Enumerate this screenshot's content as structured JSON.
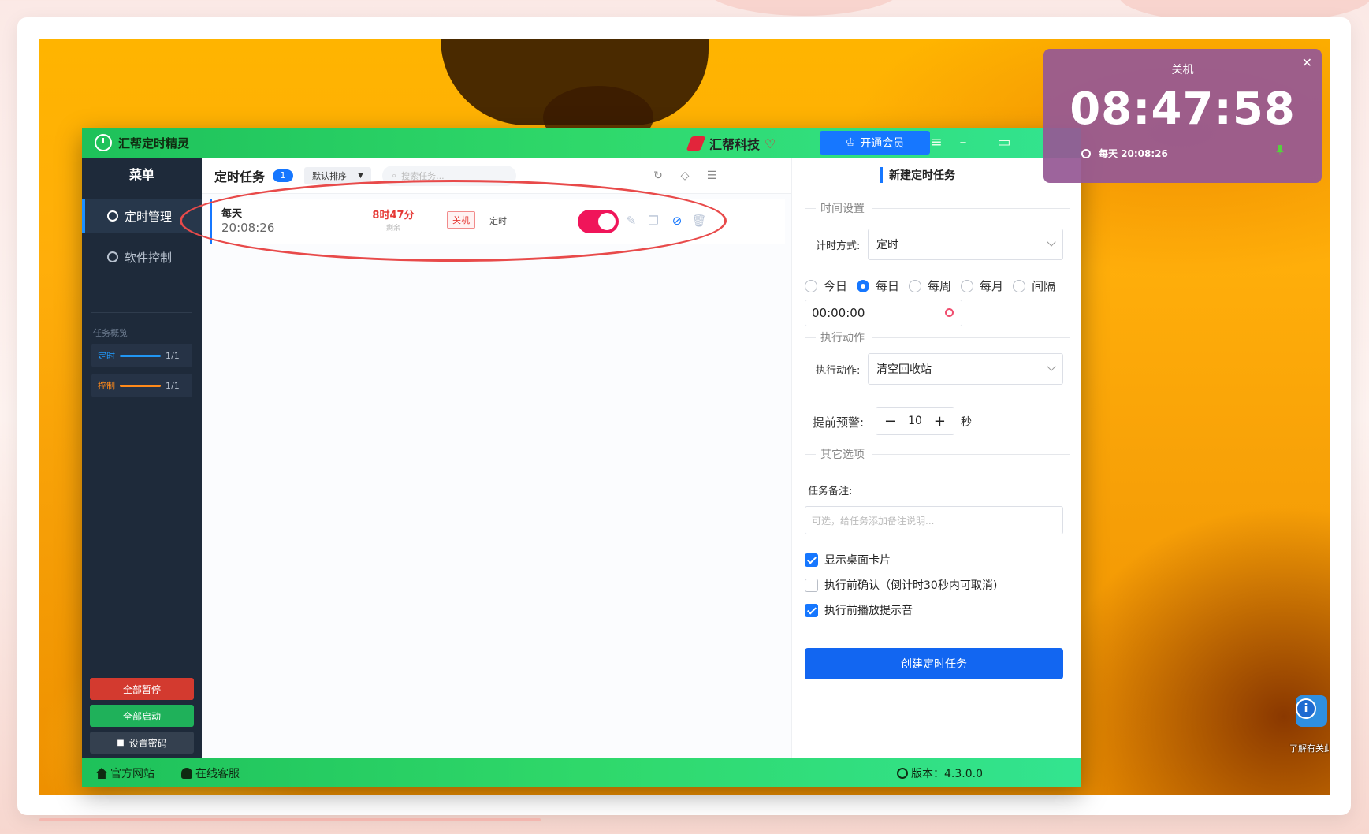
{
  "window": {
    "title": "汇帮定时精灵",
    "brand": "汇帮科技",
    "vip_label": "开通会员"
  },
  "sidebar": {
    "menu_title": "菜单",
    "items": [
      {
        "label": "定时管理"
      },
      {
        "label": "软件控制"
      }
    ],
    "overview_title": "任务概览",
    "overview": [
      {
        "label": "定时",
        "value": "1/1",
        "color": "#2196f3"
      },
      {
        "label": "控制",
        "value": "1/1",
        "color": "#ff8a1a"
      }
    ],
    "pause_all": "全部暂停",
    "start_all": "全部启动",
    "set_password": "设置密码"
  },
  "list": {
    "title": "定时任务",
    "count": "1",
    "sort": "默认排序",
    "search_placeholder": "搜索任务...",
    "tasks": [
      {
        "frequency": "每天",
        "time": "20:08:26",
        "remaining": "8时47分",
        "remaining_label": "剩余",
        "action": "关机",
        "type": "定时",
        "enabled": true
      }
    ]
  },
  "form": {
    "title": "新建定时任务",
    "time_section": "时间设置",
    "timing_mode_label": "计时方式:",
    "timing_mode": "定时",
    "options": [
      "今日",
      "每日",
      "每周",
      "每月",
      "间隔"
    ],
    "selected_option": "每日",
    "time_value": "00:00:00",
    "action_section": "执行动作",
    "action_label": "执行动作:",
    "action": "清空回收站",
    "warn_label": "提前预警:",
    "warn_value": "10",
    "warn_unit": "秒",
    "other_section": "其它选项",
    "note_label": "任务备注:",
    "note_placeholder": "可选，给任务添加备注说明...",
    "show_card": "显示桌面卡片",
    "confirm_before": "执行前确认（倒计时30秒内可取消)",
    "play_sound": "执行前播放提示音",
    "create_label": "创建定时任务"
  },
  "footer": {
    "website": "官方网站",
    "support": "在线客服",
    "version": "版本：4.3.0.0"
  },
  "clock_card": {
    "title": "关机",
    "time": "08:47:58",
    "schedule": "每天 20:08:26"
  },
  "info_widget": {
    "text": "了解有关此图片的信息"
  }
}
